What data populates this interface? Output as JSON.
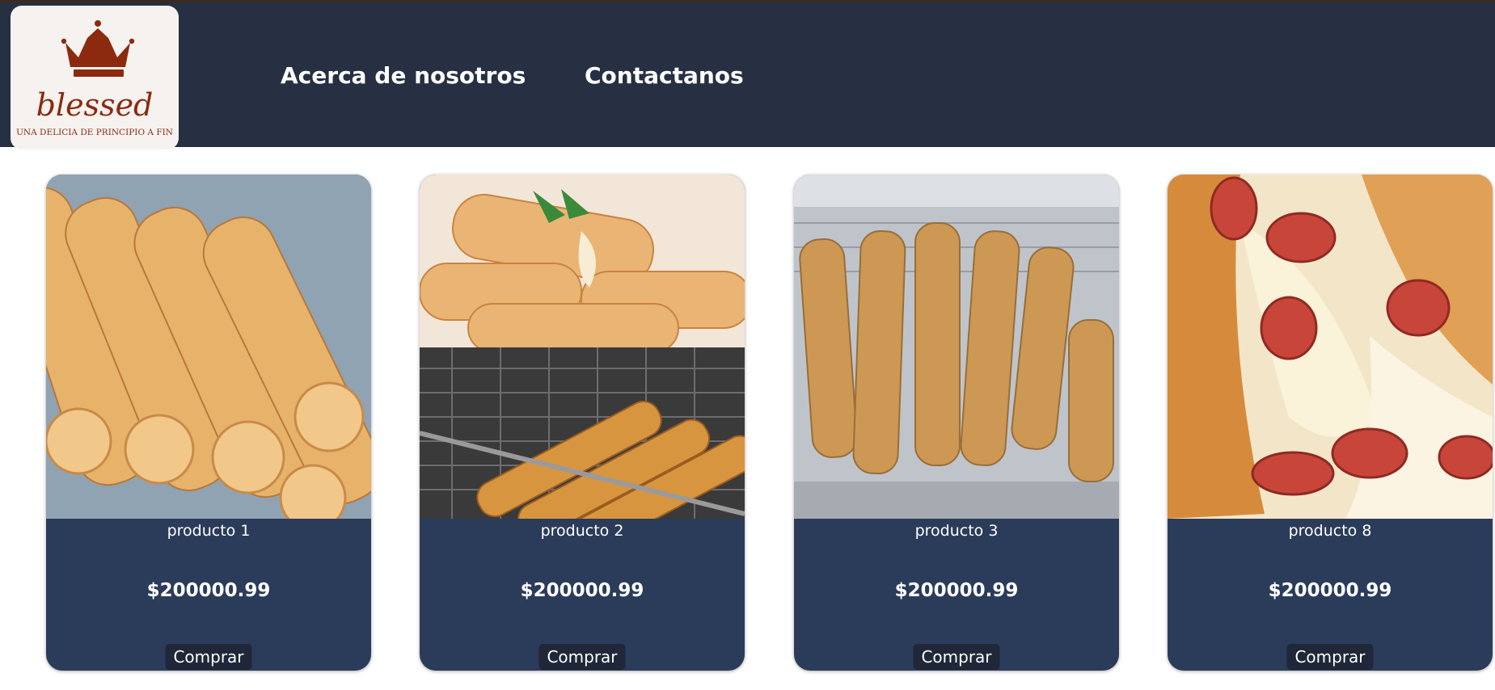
{
  "brand": {
    "name": "blessed",
    "tagline": "UNA DELICIA DE PRINCIPIO A FIN"
  },
  "nav": {
    "about": "Acerca de nosotros",
    "contact": "Contactanos"
  },
  "colors": {
    "header_bg": "#263042",
    "card_bg": "#2b3b5a",
    "button_bg": "#1f2738",
    "logo_accent": "#8b2a0e"
  },
  "products": [
    {
      "name": "producto 1",
      "price": "$200000.99",
      "button": "Comprar",
      "image": "tequeños-en-plato-photo"
    },
    {
      "name": "producto 2",
      "price": "$200000.99",
      "button": "Comprar",
      "image": "tequeños-en-freidora-photo"
    },
    {
      "name": "producto 3",
      "price": "$200000.99",
      "button": "Comprar",
      "image": "palitos-en-vitrina-photo"
    },
    {
      "name": "producto 8",
      "price": "$200000.99",
      "button": "Comprar",
      "image": "pan-pepperoni-queso-photo"
    }
  ]
}
